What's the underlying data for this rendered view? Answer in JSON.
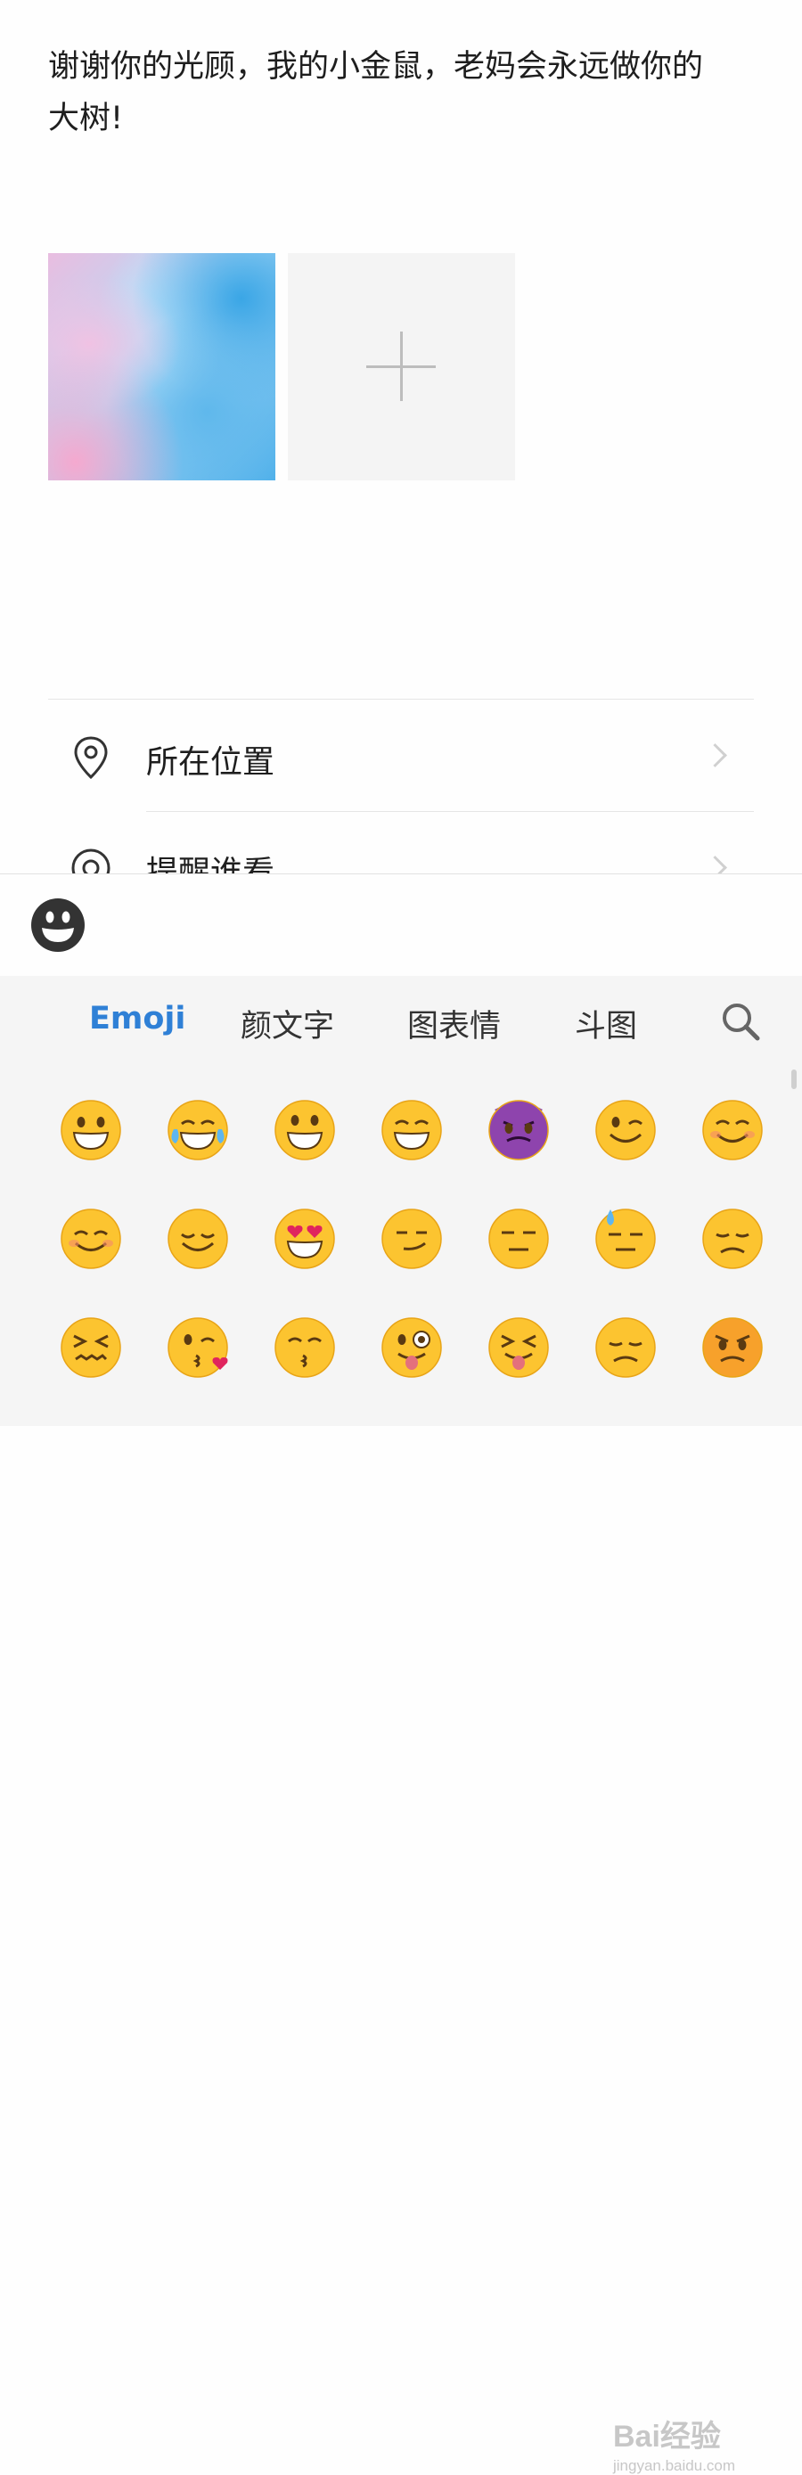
{
  "post": {
    "text": "谢谢你的光顾，我的小金鼠，老妈会永远做你的大树!"
  },
  "media": {
    "add_icon": "plus-icon"
  },
  "options": [
    {
      "label": "所在位置",
      "icon": "location-pin-icon"
    },
    {
      "label": "提醒谁看",
      "icon": "at-sign-icon"
    }
  ],
  "toolbar": {
    "emoji_toggle_icon": "smiley-face-icon"
  },
  "emoji_tabs": {
    "items": [
      "Emoji",
      "颜文字",
      "图表情",
      "斗图"
    ],
    "active": "Emoji",
    "search_icon": "search-icon",
    "active_color": "#2f80d6"
  },
  "emoji_grid": [
    [
      "grin",
      "tears-of-joy",
      "smiley",
      "grin-big",
      "smiling-imp",
      "wink",
      "blush"
    ],
    [
      "relaxed",
      "relieved",
      "heart-eyes",
      "smirk",
      "unamused",
      "sweat",
      "pensive"
    ],
    [
      "confounded",
      "kissing-heart",
      "kissing-closed-eyes",
      "stuck-out-tongue-winking",
      "stuck-out-tongue-closed-eyes",
      "disappointed",
      "angry"
    ]
  ],
  "watermark": {
    "brand": "Bai经验",
    "url": "jingyan.baidu.com"
  }
}
